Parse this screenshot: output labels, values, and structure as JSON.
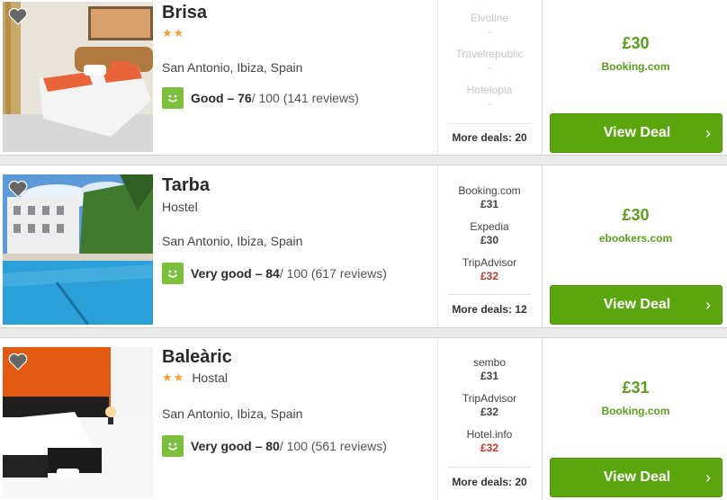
{
  "hotels": [
    {
      "name": "Brisa",
      "stars": "★★",
      "type": "",
      "location": "San Antonio, Ibiza, Spain",
      "rating_word": "Good – 76",
      "rating_rest": " / 100 (141 reviews)",
      "deals": [
        {
          "provider": "Elvoline",
          "price": "-"
        },
        {
          "provider": "Travelrepublic",
          "price": "-"
        },
        {
          "provider": "Hotelopia",
          "price": "-"
        }
      ],
      "more_deals": "More deals: 20",
      "best_price": "£30",
      "best_provider": "Booking.com",
      "cta": "View Deal",
      "cta_icon": "chevron-right-icon"
    },
    {
      "name": "Tarba",
      "stars": "",
      "type": "Hostel",
      "location": "San Antonio, Ibiza, Spain",
      "rating_word": "Very good – 84",
      "rating_rest": " / 100 (617 reviews)",
      "deals": [
        {
          "provider": "Booking.com",
          "price": "£31"
        },
        {
          "provider": "Expedia",
          "price": "£30"
        },
        {
          "provider": "TripAdvisor",
          "price": "£32"
        }
      ],
      "more_deals": "More deals: 12",
      "best_price": "£30",
      "best_provider": "ebookers.com",
      "cta": "View Deal",
      "cta_icon": "chevron-right-icon"
    },
    {
      "name": "Baleàric",
      "stars": "★★",
      "type": "Hostal",
      "location": "San Antonio, Ibiza, Spain",
      "rating_word": "Very good – 80",
      "rating_rest": " / 100 (561 reviews)",
      "deals": [
        {
          "provider": "sembo",
          "price": "£31"
        },
        {
          "provider": "TripAdvisor",
          "price": "£32"
        },
        {
          "provider": "Hotel.info",
          "price": "£32"
        }
      ],
      "more_deals": "More deals: 20",
      "best_price": "£31",
      "best_provider": "Booking.com",
      "cta": "View Deal",
      "cta_icon": "chevron-right-icon"
    }
  ],
  "colors": {
    "accent_green": "#5ba60f",
    "price_green": "#5a9e1a",
    "rating_green": "#7cbf3d",
    "star_orange": "#f2a43a",
    "price_red": "#c0392b"
  },
  "icons": [
    "heart-icon",
    "smiley-icon",
    "chevron-right-icon",
    "star-icon"
  ]
}
